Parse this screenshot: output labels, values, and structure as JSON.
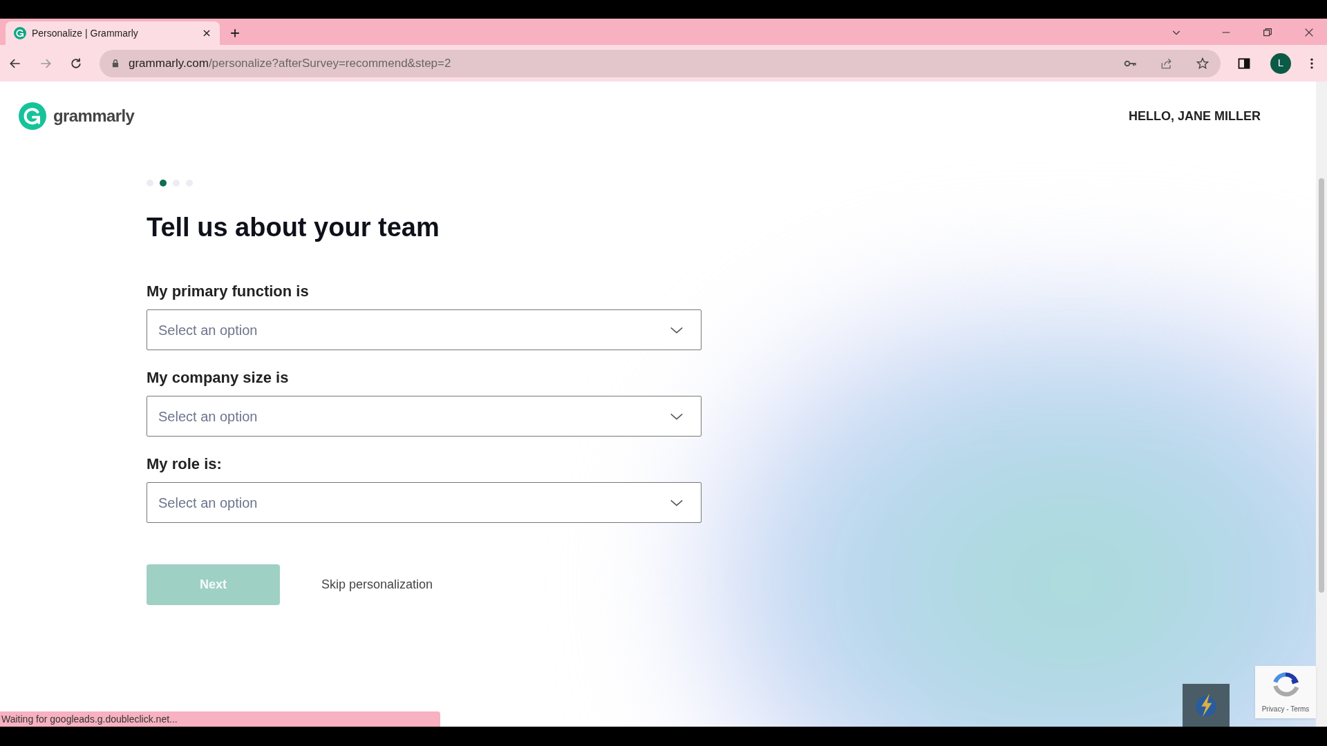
{
  "browser": {
    "tab": {
      "title": "Personalize | Grammarly",
      "selected": true
    },
    "url": {
      "host": "grammarly.com",
      "path": "/personalize?afterSurvey=recommend&step=2"
    },
    "profile_initial": "L"
  },
  "header": {
    "brand": "grammarly",
    "greeting": "HELLO, JANE MILLER"
  },
  "steps": [
    {
      "selected": false
    },
    {
      "selected": true
    },
    {
      "selected": false
    },
    {
      "selected": false
    }
  ],
  "heading": "Tell us about your team",
  "fields": [
    {
      "label": "My primary function is",
      "placeholder": "Select an option"
    },
    {
      "label": "My company size is",
      "placeholder": "Select an option"
    },
    {
      "label": "My role is:",
      "placeholder": "Select an option"
    }
  ],
  "next_button": {
    "label": "Next",
    "disabled": true
  },
  "skip_link": "Skip personalization",
  "recaptcha": {
    "links": "Privacy - Terms"
  },
  "status_bar": "Waiting for googleads.g.doubleclick.net..."
}
